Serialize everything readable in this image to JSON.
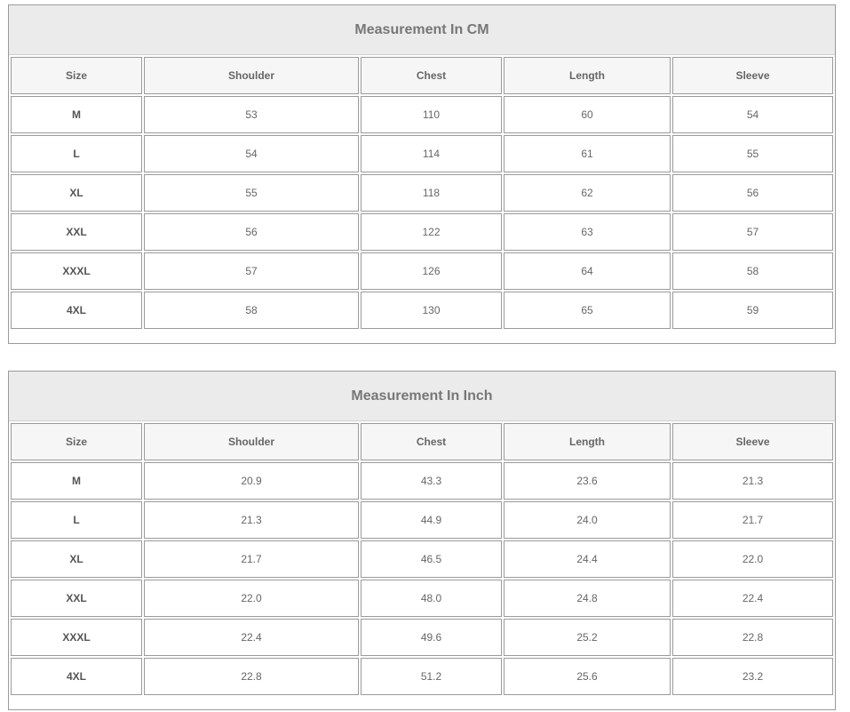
{
  "tables": [
    {
      "title": "Measurement In CM",
      "headers": [
        "Size",
        "Shoulder",
        "Chest",
        "Length",
        "Sleeve"
      ],
      "rows": [
        [
          "M",
          "53",
          "110",
          "60",
          "54"
        ],
        [
          "L",
          "54",
          "114",
          "61",
          "55"
        ],
        [
          "XL",
          "55",
          "118",
          "62",
          "56"
        ],
        [
          "XXL",
          "56",
          "122",
          "63",
          "57"
        ],
        [
          "XXXL",
          "57",
          "126",
          "64",
          "58"
        ],
        [
          "4XL",
          "58",
          "130",
          "65",
          "59"
        ]
      ]
    },
    {
      "title": "Measurement In Inch",
      "headers": [
        "Size",
        "Shoulder",
        "Chest",
        "Length",
        "Sleeve"
      ],
      "rows": [
        [
          "M",
          "20.9",
          "43.3",
          "23.6",
          "21.3"
        ],
        [
          "L",
          "21.3",
          "44.9",
          "24.0",
          "21.7"
        ],
        [
          "XL",
          "21.7",
          "46.5",
          "24.4",
          "22.0"
        ],
        [
          "XXL",
          "22.0",
          "48.0",
          "24.8",
          "22.4"
        ],
        [
          "XXXL",
          "22.4",
          "49.6",
          "25.2",
          "22.8"
        ],
        [
          "4XL",
          "22.8",
          "51.2",
          "25.6",
          "23.2"
        ]
      ]
    }
  ],
  "colors": {
    "title_background": "#ebebeb",
    "header_background": "#f6f6f6",
    "border": "#9a9a9a",
    "text": "#666666"
  }
}
